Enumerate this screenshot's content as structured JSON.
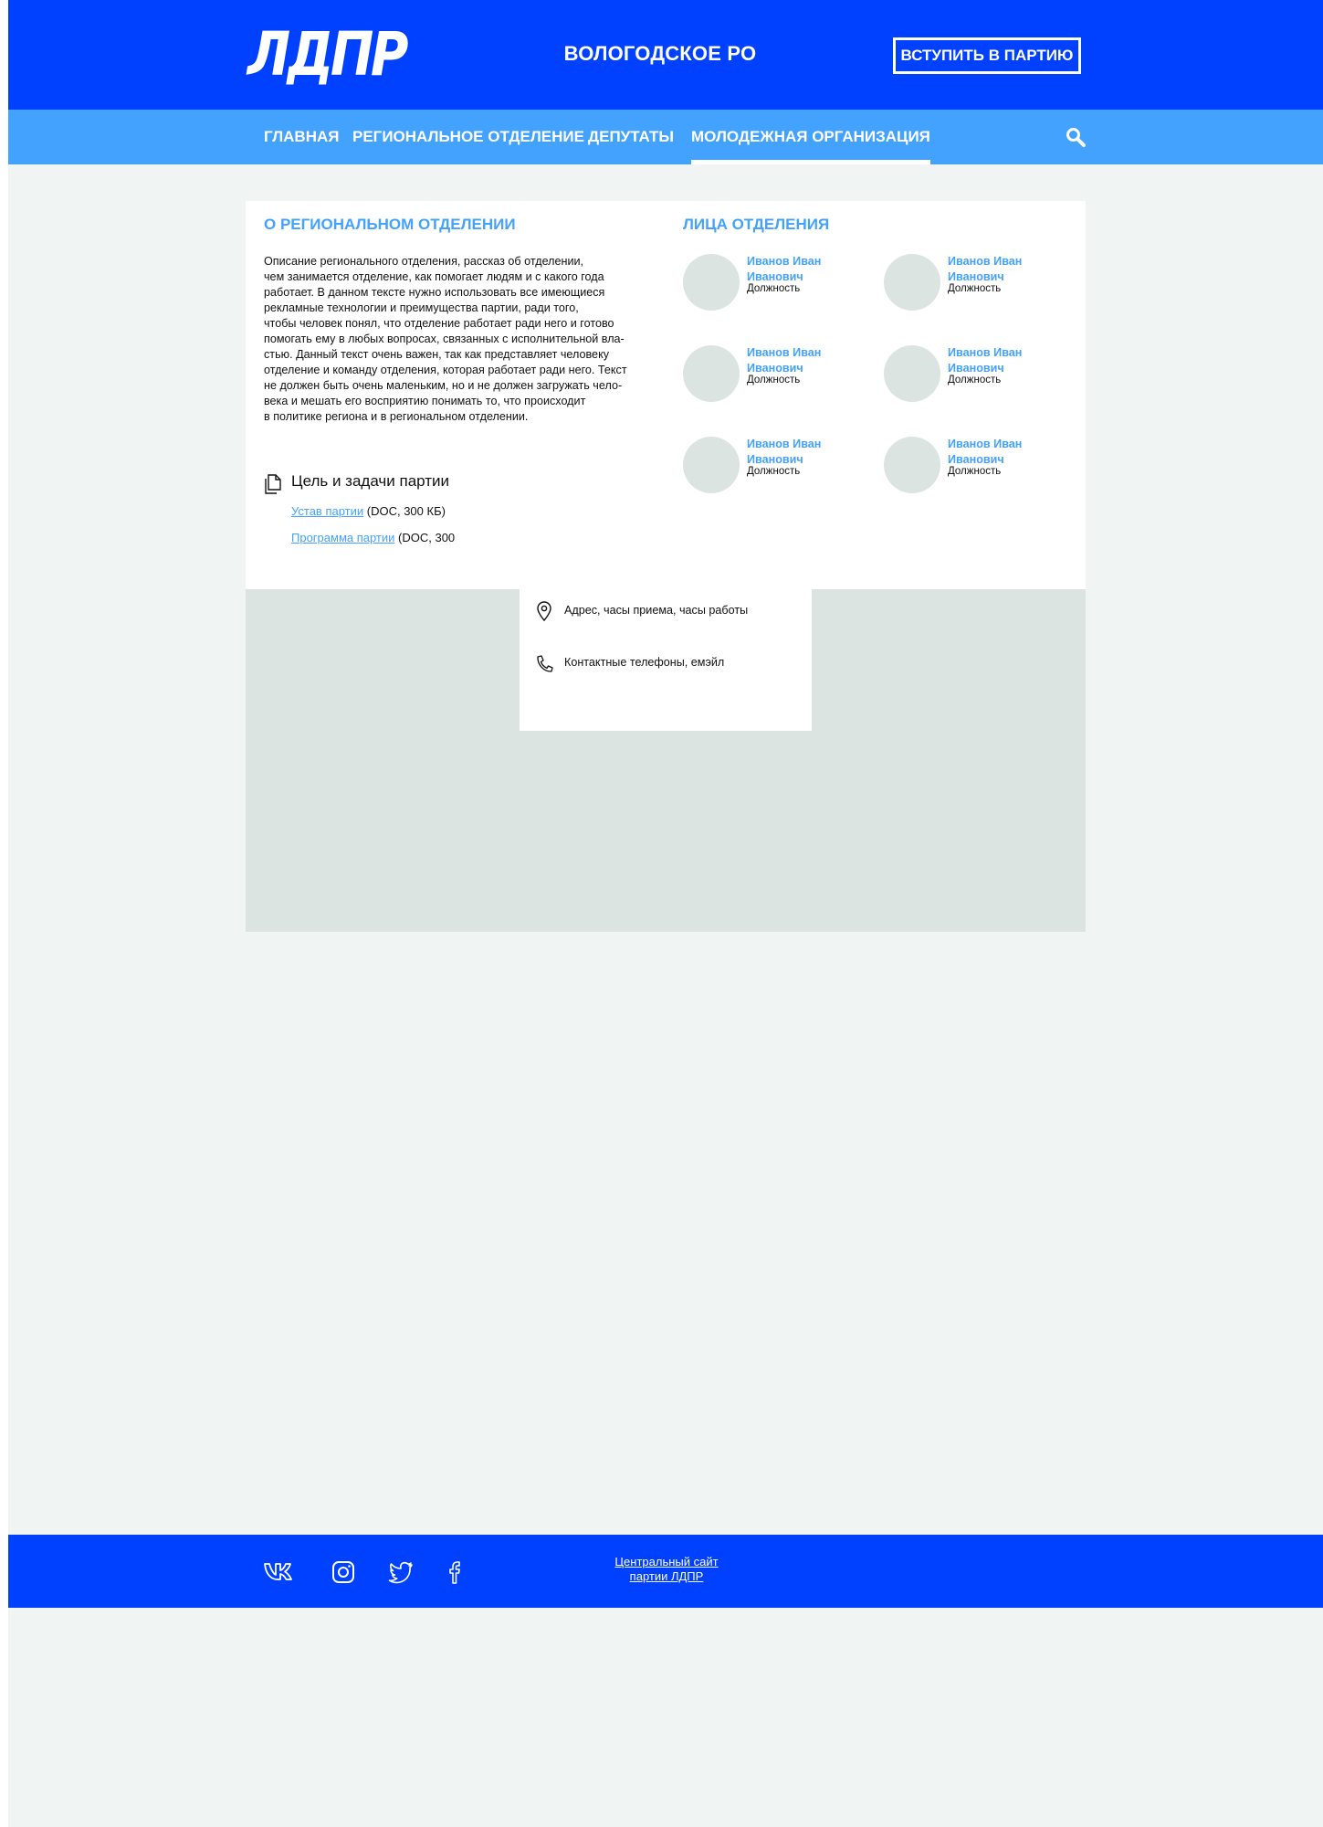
{
  "header": {
    "logo_text": "ЛДПР",
    "region_title": "ВОЛОГОДСКОЕ РО",
    "join_label": "ВСТУПИТЬ В ПАРТИЮ"
  },
  "nav": {
    "items": [
      {
        "label": "ГЛАВНАЯ"
      },
      {
        "label": "РЕГИОНАЛЬНОЕ ОТДЕЛЕНИЕ"
      },
      {
        "label": "ДЕПУТАТЫ"
      },
      {
        "label": "МОЛОДЕЖНАЯ ОРГАНИЗАЦИЯ"
      }
    ],
    "active_index": 3,
    "search_icon": "search-icon"
  },
  "about": {
    "title": "О РЕГИОНАЛЬНОМ ОТДЕЛЕНИИ",
    "text": "Описание регионального отделения, рассказ об отделении,\nчем занимается отделение, как помогает людям и с какого года\nработает. В данном тексте нужно использовать все имеющиеся\nрекламные технологии и преимущества партии, ради того,\nчтобы человек понял, что отделение работает ради него и готово\nпомогать ему в любых вопросах, связанных с исполнительной вла-\nстью. Данный текст очень важен, так как представляет человеку\nотделение и команду отделения, которая работает ради него. Текст\nне должен быть очень маленьким, но и не должен загружать чело-\nвека и мешать его восприятию понимать то, что происходит\nв политике региона и в региональном отделении."
  },
  "goals": {
    "title": "Цель и задачи партии",
    "docs": [
      {
        "link": "Устав партии",
        "meta": " (DOC, 300 КБ)"
      },
      {
        "link": "Программа партии",
        "meta": " (DOC, 300"
      }
    ]
  },
  "faces": {
    "title": "ЛИЦА ОТДЕЛЕНИЯ",
    "people": [
      {
        "name": "Иванов Иван Иванович",
        "role": "Должность"
      },
      {
        "name": "Иванов Иван Иванович",
        "role": "Должность"
      },
      {
        "name": "Иванов Иван Иванович",
        "role": "Должность"
      },
      {
        "name": "Иванов Иван Иванович",
        "role": "Должность"
      },
      {
        "name": "Иванов Иван Иванович",
        "role": "Должность"
      },
      {
        "name": "Иванов Иван Иванович",
        "role": "Должность"
      }
    ]
  },
  "contacts": {
    "address": "Адрес, часы приема, часы работы",
    "phones": "Контактные телефоны, емэйл"
  },
  "footer": {
    "social": [
      "vk-icon",
      "instagram-icon",
      "twitter-icon",
      "facebook-icon"
    ],
    "central_link_line1": "Центральный сайт",
    "central_link_line2": "партии ЛДПР"
  },
  "colors": {
    "brand_blue": "#0041ff",
    "light_blue": "#44a2ff",
    "page_bg": "#f0f5f4",
    "map_gray": "#dce4e2"
  }
}
